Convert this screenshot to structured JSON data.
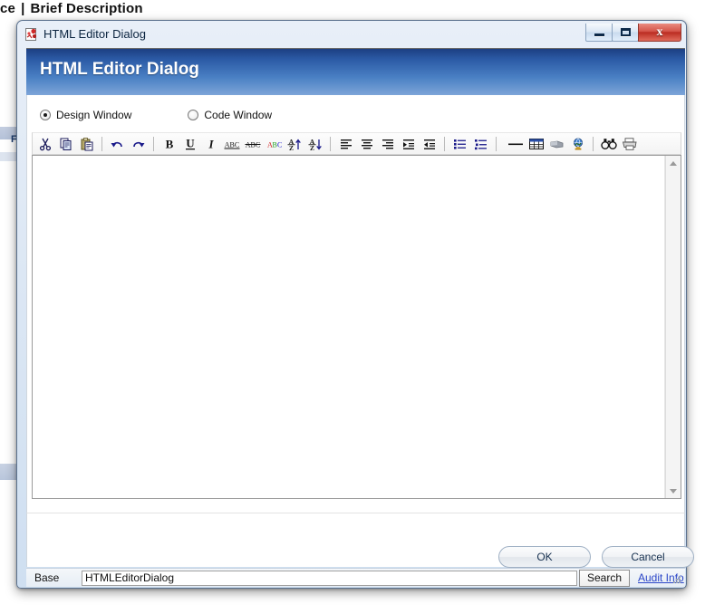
{
  "background": {
    "breadcrumb_tail": "ce",
    "breadcrumb_separator": "|",
    "breadcrumb_section": "Brief Description",
    "stray_letter": "F"
  },
  "window": {
    "titlebar_title": "HTML Editor Dialog",
    "app_icon": "html-page-icon",
    "controls": {
      "minimize": "minimize-icon",
      "maximize": "maximize-icon",
      "close": "x",
      "close_color": "#bb2d22"
    }
  },
  "header": {
    "title": "HTML Editor Dialog",
    "gradient_from": "#1c3f82",
    "gradient_to": "#7da5d8"
  },
  "view_modes": {
    "options": [
      {
        "label": "Design Window",
        "selected": true
      },
      {
        "label": "Code Window",
        "selected": false
      }
    ]
  },
  "toolbar": {
    "groups": [
      {
        "name": "clipboard",
        "buttons": [
          {
            "name": "cut-icon",
            "label": "Cut"
          },
          {
            "name": "copy-icon",
            "label": "Copy"
          },
          {
            "name": "paste-icon",
            "label": "Paste"
          }
        ]
      },
      {
        "name": "history",
        "buttons": [
          {
            "name": "undo-icon",
            "label": "Undo"
          },
          {
            "name": "redo-icon",
            "label": "Redo"
          }
        ]
      },
      {
        "name": "formatting",
        "buttons": [
          {
            "name": "bold-icon",
            "label": "Bold"
          },
          {
            "name": "underline-icon",
            "label": "Underline"
          },
          {
            "name": "italic-icon",
            "label": "Italic"
          },
          {
            "name": "spellcheck-icon",
            "label": "Spelling"
          },
          {
            "name": "strikethrough-icon",
            "label": "Strikethrough"
          },
          {
            "name": "spellcheck-color-icon",
            "label": "Check Spelling"
          },
          {
            "name": "sort-ascending-icon",
            "label": "Sort Ascending"
          },
          {
            "name": "sort-descending-icon",
            "label": "Sort Descending"
          }
        ]
      },
      {
        "name": "alignment",
        "buttons": [
          {
            "name": "align-left-icon",
            "label": "Align Left"
          },
          {
            "name": "align-center-icon",
            "label": "Align Center"
          },
          {
            "name": "align-right-icon",
            "label": "Align Right"
          },
          {
            "name": "indent-icon",
            "label": "Increase Indent"
          },
          {
            "name": "outdent-icon",
            "label": "Decrease Indent"
          }
        ]
      },
      {
        "name": "lists",
        "buttons": [
          {
            "name": "bulleted-list-icon",
            "label": "Bulleted List"
          },
          {
            "name": "numbered-list-icon",
            "label": "Numbered List"
          }
        ]
      },
      {
        "name": "insert",
        "buttons": [
          {
            "name": "horizontal-rule-icon",
            "label": "Horizontal Rule"
          },
          {
            "name": "insert-table-icon",
            "label": "Insert Table"
          },
          {
            "name": "insert-image-icon",
            "label": "Insert Image"
          },
          {
            "name": "insert-hyperlink-icon",
            "label": "Insert Hyperlink"
          }
        ]
      },
      {
        "name": "tools",
        "buttons": [
          {
            "name": "find-icon",
            "label": "Find"
          },
          {
            "name": "print-icon",
            "label": "Print"
          }
        ]
      }
    ]
  },
  "editor": {
    "content": "",
    "scrollbar": {
      "up_arrow": "scroll-up-icon",
      "down_arrow": "scroll-down-icon"
    }
  },
  "footer": {
    "ok_label": "OK",
    "cancel_label": "Cancel"
  },
  "statusbar": {
    "base_label": "Base",
    "base_value": "HTMLEditorDialog",
    "base_placeholder": "",
    "search_label": "Search",
    "audit_link_label": "Audit Info",
    "link_color": "#2b46c8"
  }
}
